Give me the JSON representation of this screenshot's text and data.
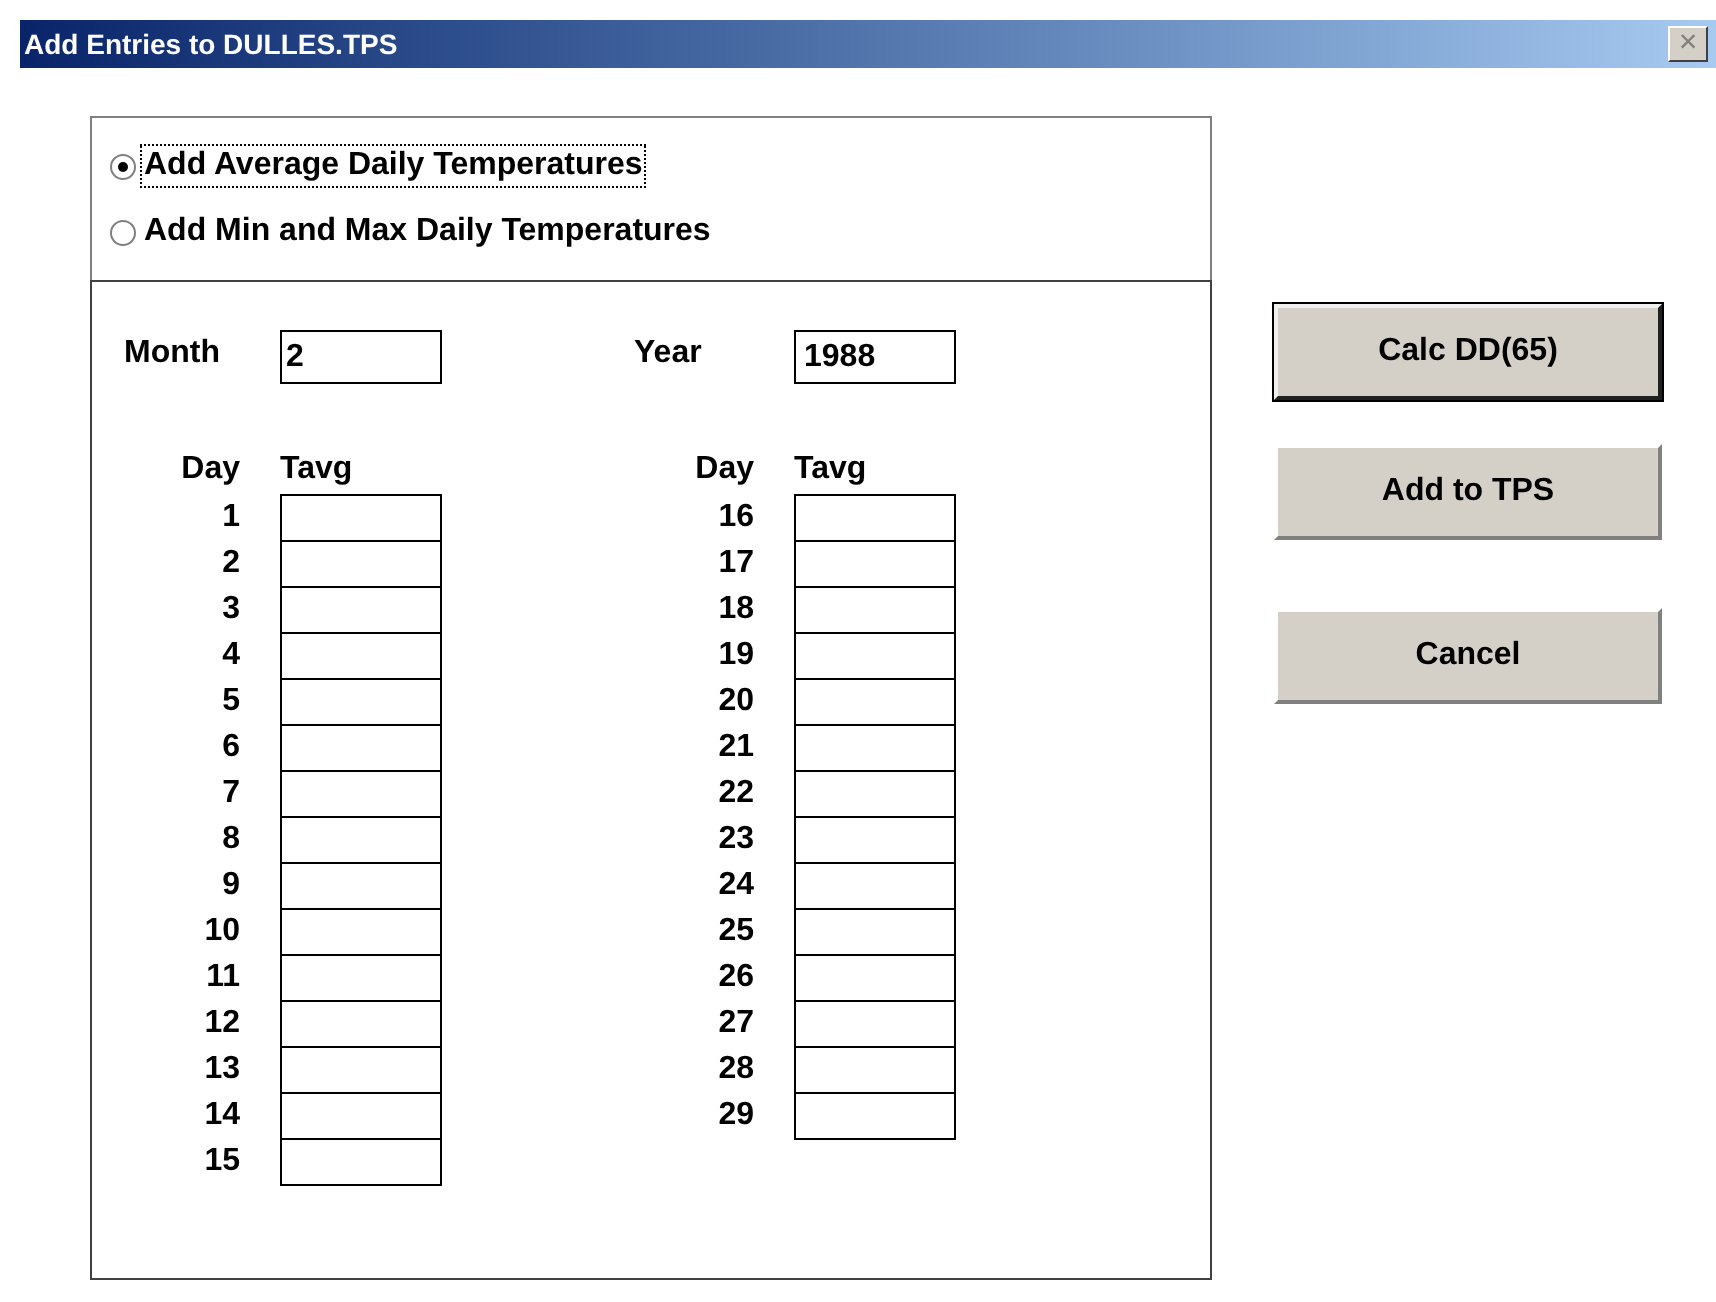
{
  "window": {
    "title": "Add Entries to DULLES.TPS",
    "close": "×"
  },
  "mode_options": [
    {
      "label": "Add Average Daily Temperatures",
      "selected": true,
      "focused": true
    },
    {
      "label": "Add Min and Max Daily Temperatures",
      "selected": false,
      "focused": false
    }
  ],
  "month": {
    "label": "Month",
    "value": "2"
  },
  "year": {
    "label": "Year",
    "value": "1988"
  },
  "columns": [
    {
      "day_header": "Day",
      "value_header": "Tavg",
      "days": [
        "1",
        "2",
        "3",
        "4",
        "5",
        "6",
        "7",
        "8",
        "9",
        "10",
        "11",
        "12",
        "13",
        "14",
        "15"
      ]
    },
    {
      "day_header": "Day",
      "value_header": "Tavg",
      "days": [
        "16",
        "17",
        "18",
        "19",
        "20",
        "21",
        "22",
        "23",
        "24",
        "25",
        "26",
        "27",
        "28",
        "29"
      ]
    }
  ],
  "buttons": [
    {
      "label": "Calc DD(65)",
      "default": true
    },
    {
      "label": "Add to TPS",
      "default": false
    },
    {
      "label": "Cancel",
      "default": false
    }
  ]
}
